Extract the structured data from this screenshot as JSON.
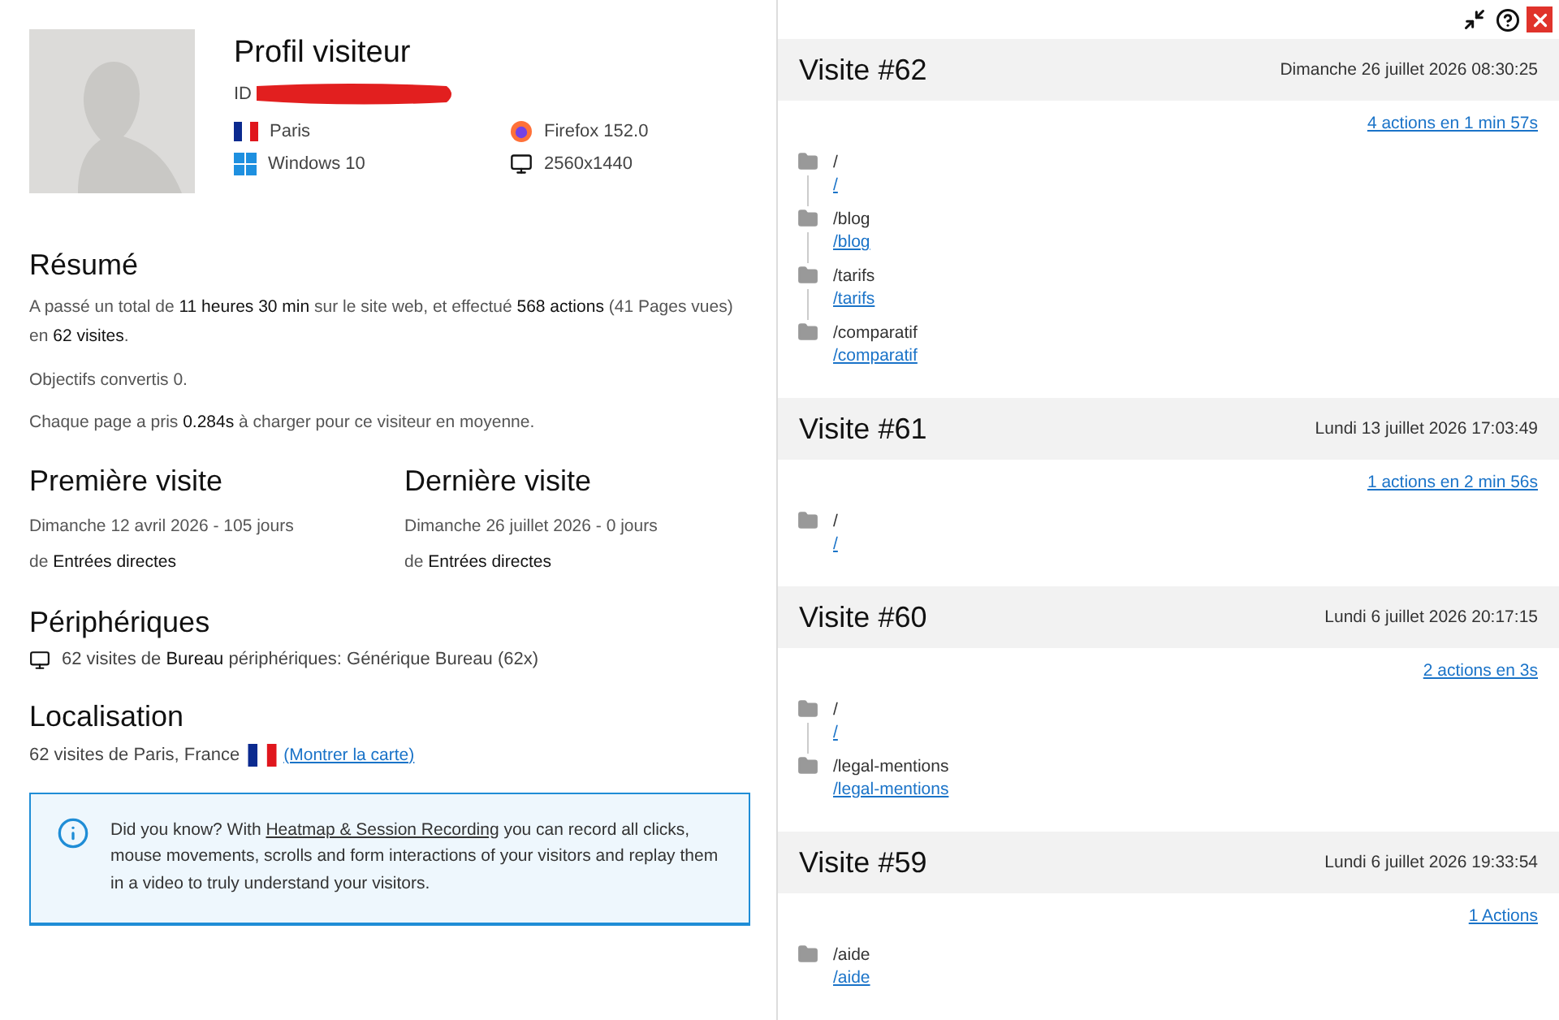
{
  "profile": {
    "title": "Profil visiteur",
    "id_label": "ID",
    "location": "Paris",
    "browser": "Firefox 152.0",
    "os": "Windows 10",
    "resolution": "2560x1440"
  },
  "summary": {
    "title": "Résumé",
    "paragraphs": [
      "A passé un total de **11 heures 30 min** sur le site web, et effectué **568 actions** (41 Pages vues) en **62 visites**.",
      "Objectifs convertis 0.",
      "Chaque page a pris **0.284s** à charger pour ce visiteur en moyenne."
    ]
  },
  "first_visit": {
    "title": "Première visite",
    "date": "Dimanche 12 avril 2026 - 105 jours",
    "source": "de **Entrées directes**"
  },
  "last_visit": {
    "title": "Dernière visite",
    "date": "Dimanche 26 juillet 2026 - 0 jours",
    "source": "de **Entrées directes**"
  },
  "devices": {
    "title": "Périphériques",
    "text": "62 visites de **Bureau** périphériques: Générique Bureau (62x)"
  },
  "location": {
    "title": "Localisation",
    "text": "62 visites de Paris, France",
    "link": "(Montrer la carte)"
  },
  "info": {
    "before": "Did you know? With ",
    "link": "Heatmap & Session Recording",
    "after": " you can record all clicks, mouse movements, scrolls and form interactions of your visitors and replay them in a video to truly understand your visitors."
  },
  "visits": [
    {
      "title": "Visite #62",
      "date": "Dimanche 26 juillet 2026 08:30:25",
      "actions": "4 actions en 1 min 57s",
      "pages": [
        {
          "title": "/",
          "url": "/"
        },
        {
          "title": "/blog",
          "url": "/blog"
        },
        {
          "title": "/tarifs",
          "url": "/tarifs"
        },
        {
          "title": "/comparatif",
          "url": "/comparatif"
        }
      ]
    },
    {
      "title": "Visite #61",
      "date": "Lundi 13 juillet 2026 17:03:49",
      "actions": "1 actions en 2 min 56s",
      "pages": [
        {
          "title": "/",
          "url": "/"
        }
      ]
    },
    {
      "title": "Visite #60",
      "date": "Lundi 6 juillet 2026 20:17:15",
      "actions": "2 actions en 3s",
      "pages": [
        {
          "title": "/",
          "url": "/"
        },
        {
          "title": "/legal-mentions",
          "url": "/legal-mentions"
        }
      ]
    },
    {
      "title": "Visite #59",
      "date": "Lundi 6 juillet 2026 19:33:54",
      "actions": "1 Actions",
      "pages": [
        {
          "title": "/aide",
          "url": "/aide"
        }
      ]
    }
  ]
}
